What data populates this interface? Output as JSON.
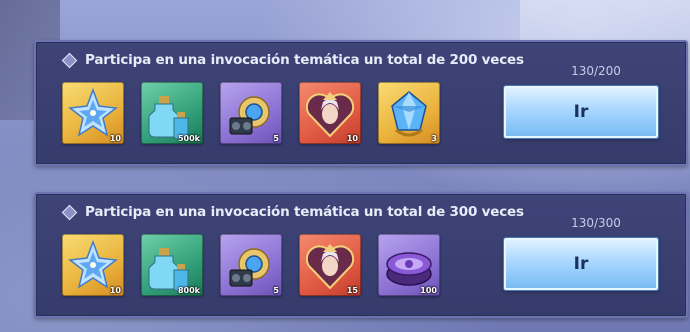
{
  "colors": {
    "panel_bg": "#3a4072",
    "panel_border": "#6b74b0",
    "button_top": "#dff1ff",
    "button_bottom": "#79bbf2",
    "title_text": "#e8ebf8"
  },
  "tasks": [
    {
      "title": "Participa en una invocación temática un total de 200 veces",
      "progress": "130/200",
      "button_label": "Ir",
      "rewards": [
        {
          "icon": "blue-star-crystal-icon",
          "quantity": "10",
          "frame": "gold"
        },
        {
          "icon": "potion-bottles-icon",
          "quantity": "500k",
          "frame": "green"
        },
        {
          "icon": "mechanical-gear-device-icon",
          "quantity": "5",
          "frame": "purple"
        },
        {
          "icon": "character-heart-portrait-icon",
          "quantity": "10",
          "frame": "red"
        },
        {
          "icon": "blue-gem-icon",
          "quantity": "3",
          "frame": "gold"
        }
      ]
    },
    {
      "title": "Participa en una invocación temática un total de 300 veces",
      "progress": "130/300",
      "button_label": "Ir",
      "rewards": [
        {
          "icon": "blue-star-crystal-icon",
          "quantity": "10",
          "frame": "gold"
        },
        {
          "icon": "potion-bottles-icon",
          "quantity": "800k",
          "frame": "green"
        },
        {
          "icon": "mechanical-gear-device-icon",
          "quantity": "5",
          "frame": "purple"
        },
        {
          "icon": "character-heart-portrait-icon",
          "quantity": "15",
          "frame": "red"
        },
        {
          "icon": "purple-treasure-box-icon",
          "quantity": "100",
          "frame": "purple"
        }
      ]
    }
  ]
}
